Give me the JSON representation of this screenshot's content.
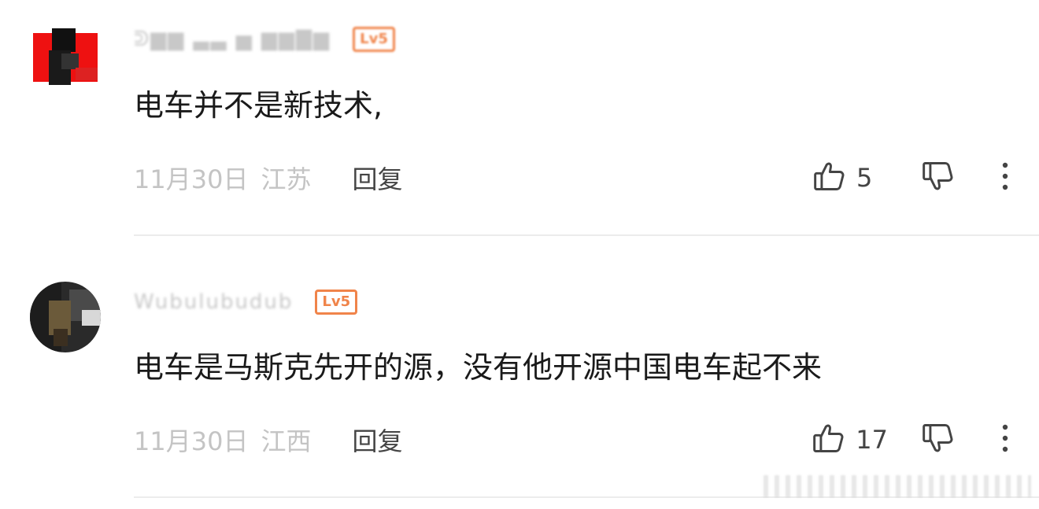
{
  "comments": [
    {
      "username": "ᕲ▆▆ ▃▃ ▅ ▆▆▇▆",
      "level": "Lv5",
      "text": "电车并不是新技术,",
      "date": "11月30日",
      "location": "江苏",
      "reply_label": "回复",
      "likes": "5"
    },
    {
      "username": "Wubulubudub",
      "level": "Lv5",
      "text": "电车是马斯克先开的源，没有他开源中国电车起不来",
      "date": "11月30日",
      "location": "江西",
      "reply_label": "回复",
      "likes": "17"
    }
  ],
  "icons": {
    "like": "thumbs-up-icon",
    "dislike": "thumbs-down-icon",
    "more": "more-vertical-icon"
  },
  "colors": {
    "text": "#1a1a1a",
    "meta": "#c4c4c4",
    "badge": "#f0844a",
    "divider": "#ececec"
  }
}
